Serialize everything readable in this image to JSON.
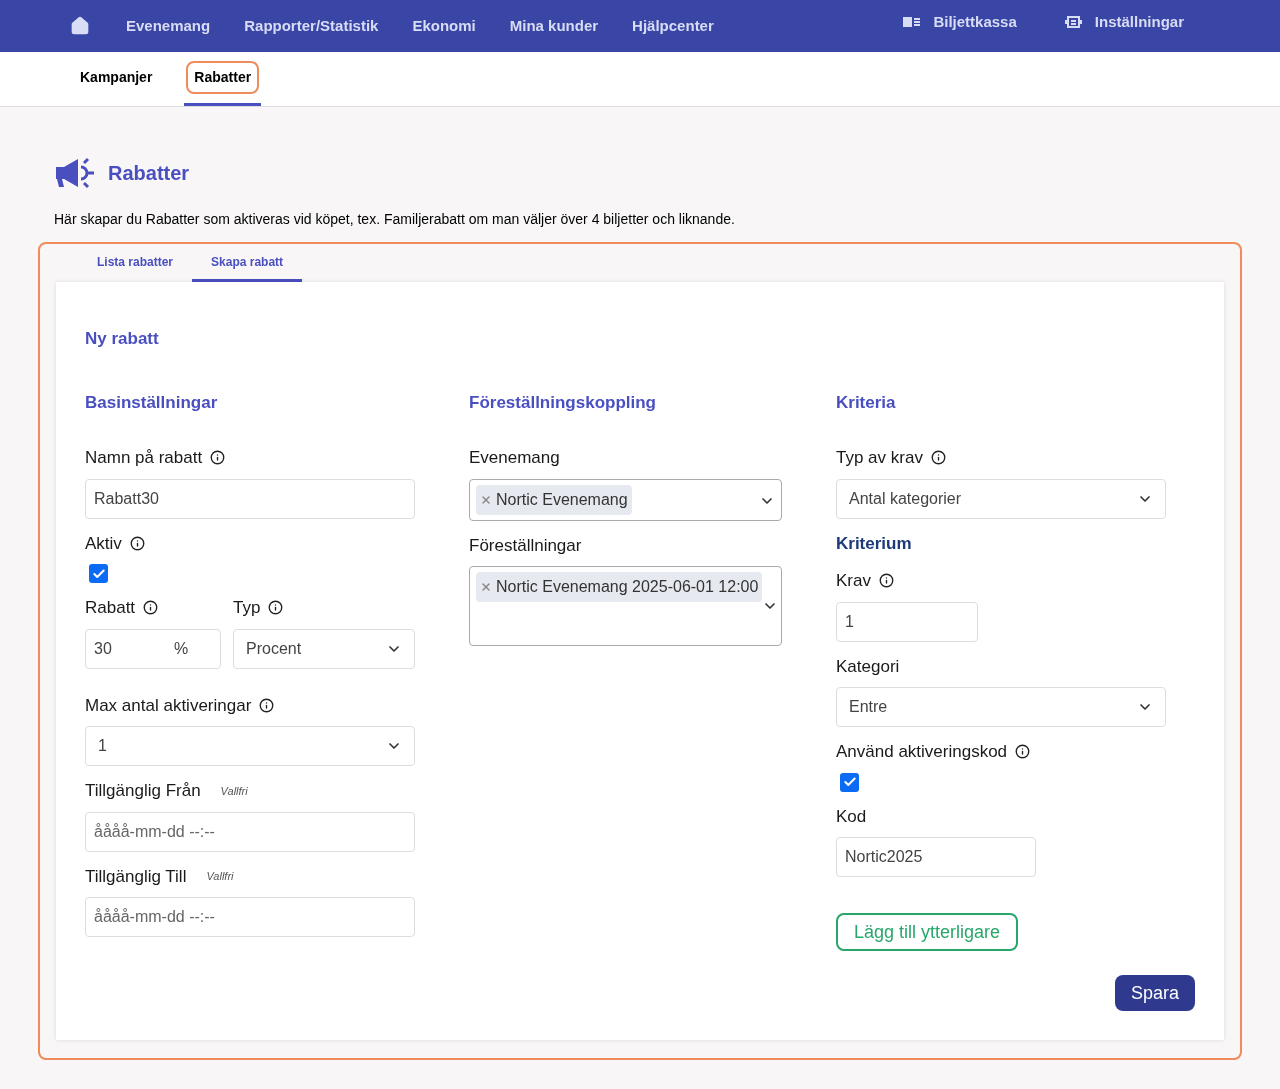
{
  "nav": {
    "items": [
      {
        "label": "Evenemang"
      },
      {
        "label": "Rapporter/Statistik"
      },
      {
        "label": "Ekonomi"
      },
      {
        "label": "Mina kunder"
      },
      {
        "label": "Hjälpcenter"
      }
    ],
    "right": [
      {
        "kind": "cashier",
        "label": "Biljettkassa"
      },
      {
        "kind": "settings",
        "label": "Inställningar"
      }
    ]
  },
  "subnav": [
    {
      "label": "Kampanjer",
      "selected": false,
      "highlighted": false
    },
    {
      "label": "Rabatter",
      "selected": true,
      "highlighted": true
    }
  ],
  "page": {
    "title": "Rabatter",
    "description": "Här skapar du Rabatter som aktiveras vid köpet, tex. Familjerabatt om man väljer över 4 biljetter och liknande.",
    "highlighted": true
  },
  "tabs": [
    {
      "label": "Lista rabatter",
      "selected": false
    },
    {
      "label": "Skapa rabatt",
      "selected": true
    }
  ],
  "form": {
    "title": "Ny rabatt",
    "columns": [
      {
        "heading": "Basinställningar",
        "fields": [
          {
            "kind": "text",
            "label": "Namn på rabatt",
            "info": true,
            "value": "Rabatt30"
          },
          {
            "kind": "checkbox",
            "label": "Aktiv",
            "info": true,
            "checked": true
          },
          {
            "kind": "pair",
            "items": [
              {
                "kind": "suffix",
                "label": "Rabatt",
                "info": true,
                "value": "30",
                "suffix": "%"
              },
              {
                "kind": "select",
                "label": "Typ",
                "info": true,
                "value": "Procent"
              }
            ]
          },
          {
            "kind": "select",
            "label": "Max antal aktiveringar",
            "info": true,
            "value": "1"
          },
          {
            "kind": "text",
            "label": "Tillgänglig Från",
            "note": "Vallfri",
            "placeholder": "åååå-mm-dd --:--"
          },
          {
            "kind": "text",
            "label": "Tillgänglig Till",
            "note": "Vallfri",
            "placeholder": "åååå-mm-dd --:--"
          }
        ]
      },
      {
        "heading": "Föreställningskoppling",
        "fields": [
          {
            "kind": "multi",
            "label": "Evenemang",
            "tags": [
              "Nortic Evenemang"
            ]
          },
          {
            "kind": "multi-area",
            "label": "Föreställningar",
            "tags": [
              "Nortic Evenemang 2025-06-01 12:00"
            ]
          }
        ]
      },
      {
        "heading": "Kriteria",
        "fields": [
          {
            "kind": "select",
            "label": "Typ av krav",
            "info": true,
            "value": "Antal kategorier"
          },
          {
            "kind": "subheading",
            "label": "Kriterium"
          },
          {
            "kind": "number",
            "label": "Krav",
            "info": true,
            "value": "1"
          },
          {
            "kind": "select",
            "label": "Kategori",
            "value": "Entre"
          },
          {
            "kind": "checkbox",
            "label": "Använd aktiveringskod",
            "info": true,
            "checked": true
          },
          {
            "kind": "code",
            "label": "Kod",
            "value": "Nortic2025"
          },
          {
            "kind": "button",
            "label": "Lägg till ytterligare"
          }
        ]
      }
    ],
    "save": "Spara"
  }
}
